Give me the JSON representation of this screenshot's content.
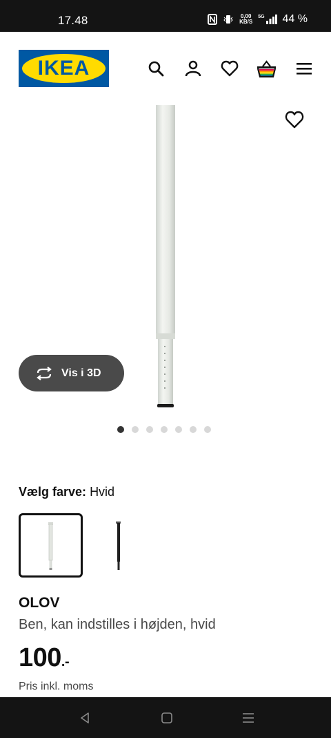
{
  "status_bar": {
    "time": "17.48",
    "data_rate_top": "0,00",
    "data_rate_bottom": "KB/S",
    "network": "5G",
    "battery": "44 %"
  },
  "header": {
    "logo_text": "IKEA",
    "icons": [
      "search-icon",
      "account-icon",
      "heart-icon",
      "basket-icon",
      "menu-icon"
    ]
  },
  "gallery": {
    "button_3d_label": "Vis i 3D",
    "dots_total": 7,
    "dots_active": 1
  },
  "color_select": {
    "label": "Vælg farve:",
    "value": "Hvid",
    "options": [
      "Hvid",
      "Sort"
    ]
  },
  "product": {
    "name": "OLOV",
    "description": "Ben, kan indstilles i højden, hvid",
    "price_main": "100",
    "price_suffix": ".-",
    "price_note": "Pris inkl. moms"
  },
  "colors": {
    "ikea_blue": "#0058a3",
    "ikea_yellow": "#ffdb00",
    "button_dark": "#4a4a4a"
  }
}
